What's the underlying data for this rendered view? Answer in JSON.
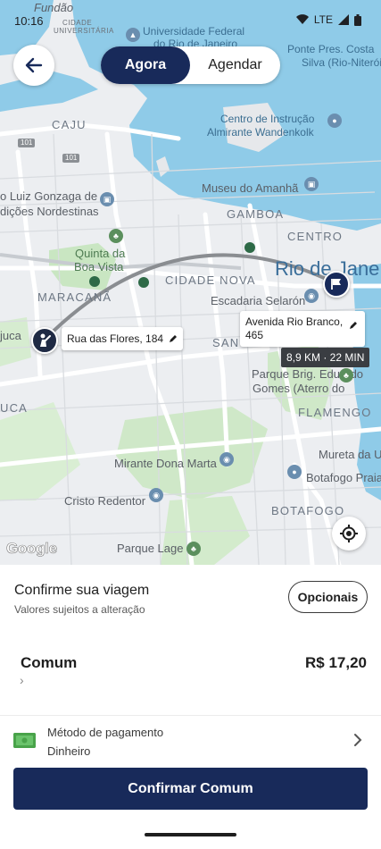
{
  "status_bar": {
    "time": "10:16",
    "network": "LTE"
  },
  "header": {
    "tab_now": "Agora",
    "tab_schedule": "Agendar",
    "active_tab": "Agora"
  },
  "map": {
    "labels": {
      "fundao": "Fundão",
      "cidade_universitaria_1": "CIDADE",
      "cidade_universitaria_2": "UNIVERSITÁRIA",
      "universidade_1": "Universidade Federal",
      "universidade_2": "do Rio de Janeiro",
      "ponte_1": "Ponte Pres. Costa",
      "ponte_2": "Silva (Rio-Niterói)",
      "caju": "CAJU",
      "centro_instrucao_1": "Centro de Instrução",
      "centro_instrucao_2": "Almirante Wandenkolk",
      "museu": "Museu do Amanhã",
      "gamboa": "GAMBOA",
      "centro": "CENTRO",
      "rio": "Rio de Jane",
      "luiz_gonzaga_1": "o Luiz Gonzaga de",
      "luiz_gonzaga_2": "dições Nordestinas",
      "quinta_1": "Quinta da",
      "quinta_2": "Boa Vista",
      "maracana": "MARACANÃ",
      "cidade_nova": "CIDADE NOVA",
      "escadaria": "Escadaria Selarón",
      "tijuca": "juca",
      "sao": "SAN",
      "parque_brig_1": "Parque Brig. Eduardo",
      "parque_brig_2": "Gomes (Aterro do",
      "flamengo": "FLAMENGO",
      "uca": "UCA",
      "mureta_1": "Mureta da U",
      "botafogo_praia": "Botafogo Praia",
      "mirante": "Mirante Dona Marta",
      "cristo": "Cristo Redentor",
      "botafogo": "BOTAFOGO",
      "parque_lage": "Parque Lage",
      "road_101_a": "101",
      "road_101_b": "101",
      "google": "Google"
    },
    "origin_tag": "Rua das Flores, 184",
    "destination_tag": "Avenida Rio Branco, 465",
    "eta": "8,9 KM · 22 MIN"
  },
  "sheet": {
    "title": "Confirme sua viagem",
    "subtitle": "Valores sujeitos a alteração",
    "options_button": "Opcionais",
    "ride": {
      "name": "Comum",
      "price": "R$ 17,20"
    },
    "payment": {
      "label": "Método de pagamento",
      "value": "Dinheiro"
    },
    "confirm_button": "Confirmar Comum"
  },
  "colors": {
    "brand_navy": "#182a5a",
    "water": "#8ecbe8",
    "park": "#c8e6c0",
    "cash_green": "#49a34a"
  }
}
